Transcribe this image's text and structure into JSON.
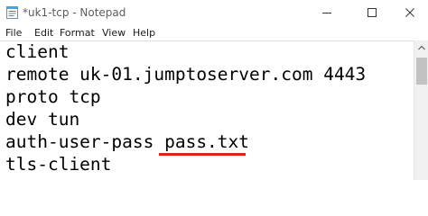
{
  "window": {
    "title": "*uk1-tcp - Notepad"
  },
  "menu": {
    "file": "File",
    "edit": "Edit",
    "format": "Format",
    "view": "View",
    "help": "Help"
  },
  "editor": {
    "lines": [
      "client",
      "remote uk-01.jumptoserver.com 4443",
      "proto tcp",
      "dev tun",
      "auth-user-pass pass.txt",
      "tls-client"
    ],
    "highlight_color": "#e02020"
  },
  "icons": {
    "app": "notepad-icon",
    "minimize": "minimize-icon",
    "maximize": "maximize-icon",
    "close": "close-icon",
    "scroll_up": "chevron-up-icon"
  }
}
